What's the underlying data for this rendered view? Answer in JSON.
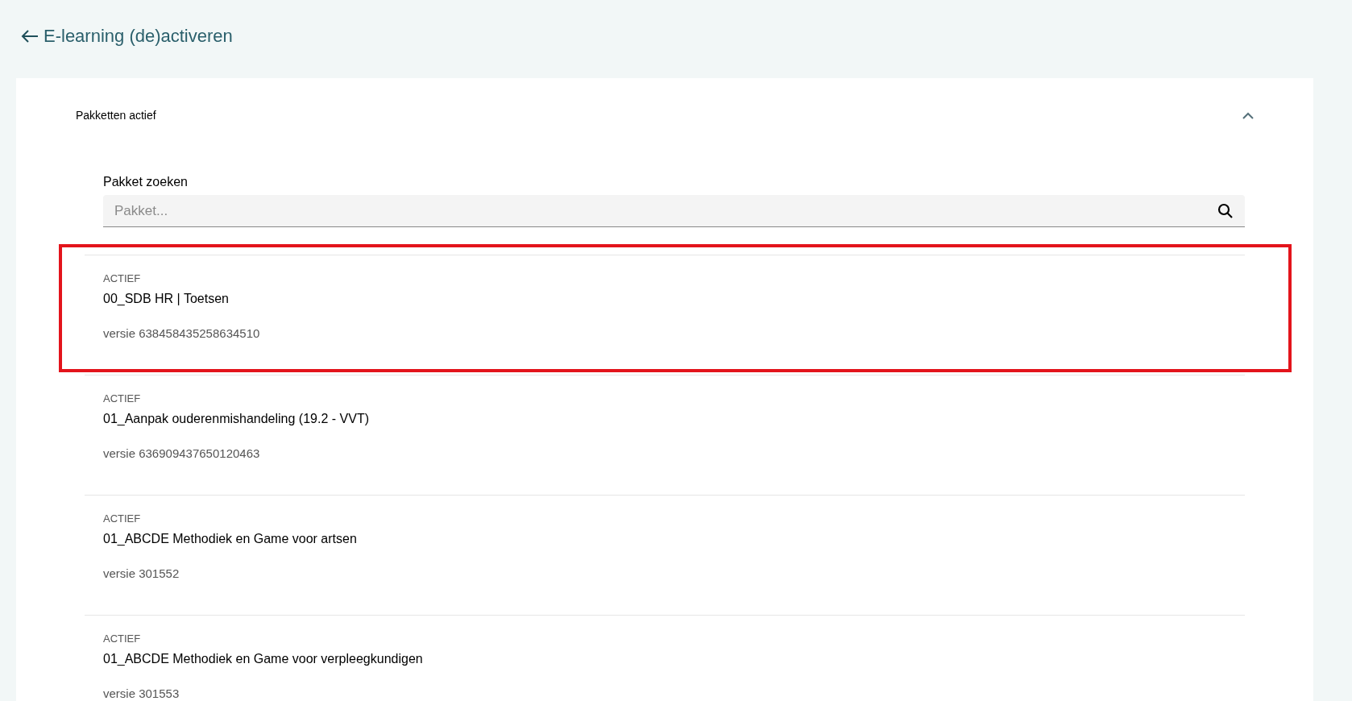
{
  "header": {
    "title": "E-learning (de)activeren"
  },
  "section": {
    "title": "Pakketten actief",
    "expanded": true
  },
  "search": {
    "label": "Pakket zoeken",
    "placeholder": "Pakket..."
  },
  "packages": [
    {
      "status": "ACTIEF",
      "name": "00_SDB HR | Toetsen",
      "version": "versie 638458435258634510",
      "highlighted": true
    },
    {
      "status": "ACTIEF",
      "name": "01_Aanpak ouderenmishandeling (19.2 - VVT)",
      "version": "versie 636909437650120463",
      "highlighted": false
    },
    {
      "status": "ACTIEF",
      "name": "01_ABCDE Methodiek en Game voor artsen",
      "version": "versie 301552",
      "highlighted": false
    },
    {
      "status": "ACTIEF",
      "name": "01_ABCDE Methodiek en Game voor verpleegkundigen",
      "version": "versie 301553",
      "highlighted": false
    }
  ]
}
